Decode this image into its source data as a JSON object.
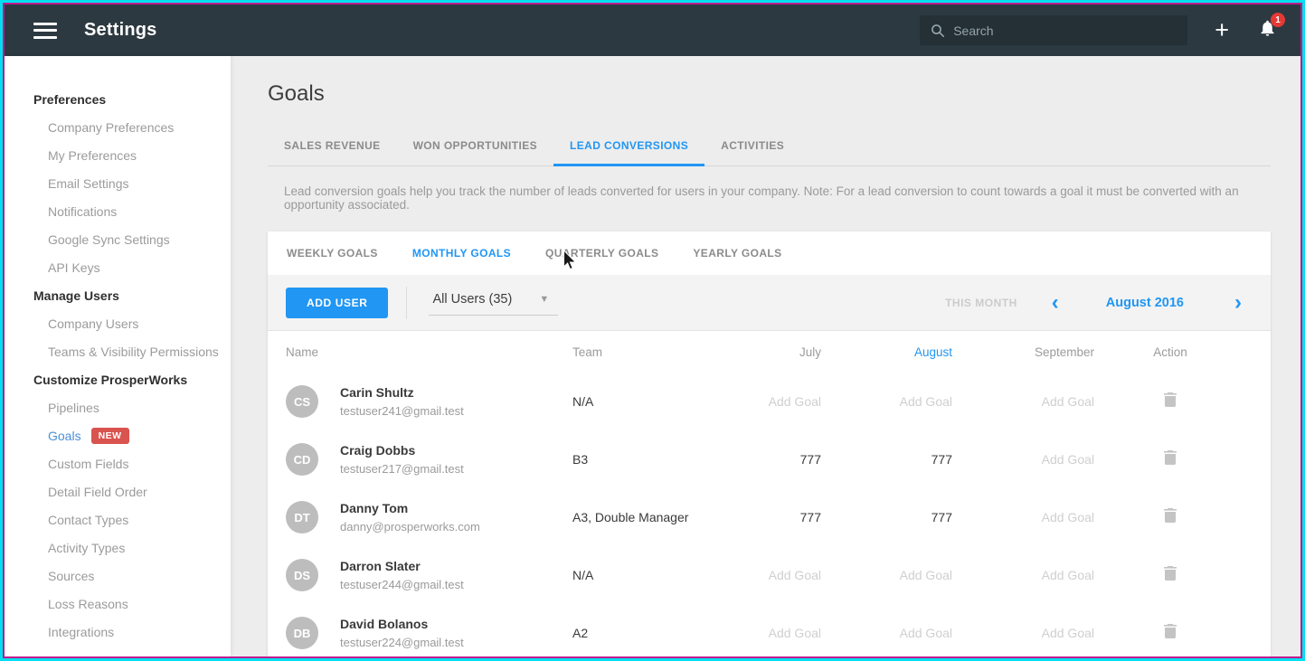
{
  "colors": {
    "accent_blue": "#2196f3",
    "topbar_bg": "#2d3940",
    "new_badge_red": "#d9534f",
    "notification_red": "#e53935",
    "frame_cyan": "#00dff0",
    "frame_magenta": "#bf1b8c"
  },
  "header": {
    "title": "Settings",
    "search_placeholder": "Search",
    "plus_label": "+",
    "notification_count": "1"
  },
  "sidebar": {
    "sections": [
      {
        "title": "Preferences",
        "items": [
          {
            "label": "Company Preferences"
          },
          {
            "label": "My Preferences"
          },
          {
            "label": "Email Settings"
          },
          {
            "label": "Notifications"
          },
          {
            "label": "Google Sync Settings"
          },
          {
            "label": "API Keys"
          }
        ]
      },
      {
        "title": "Manage Users",
        "items": [
          {
            "label": "Company Users"
          },
          {
            "label": "Teams & Visibility Permissions"
          }
        ]
      },
      {
        "title": "Customize ProsperWorks",
        "items": [
          {
            "label": "Pipelines"
          },
          {
            "label": "Goals",
            "badge": "NEW",
            "active": true
          },
          {
            "label": "Custom Fields"
          },
          {
            "label": "Detail Field Order"
          },
          {
            "label": "Contact Types"
          },
          {
            "label": "Activity Types"
          },
          {
            "label": "Sources"
          },
          {
            "label": "Loss Reasons"
          },
          {
            "label": "Integrations"
          }
        ]
      }
    ]
  },
  "main": {
    "title": "Goals",
    "tabs": [
      {
        "label": "SALES REVENUE"
      },
      {
        "label": "WON OPPORTUNITIES"
      },
      {
        "label": "LEAD CONVERSIONS",
        "active": true
      },
      {
        "label": "ACTIVITIES"
      }
    ],
    "description": "Lead conversion goals help you track the number of leads converted for users in your company. Note: For a lead conversion to count towards a goal it must be converted with an opportunity associated.",
    "subtabs": [
      {
        "label": "WEEKLY GOALS"
      },
      {
        "label": "MONTHLY GOALS",
        "active": true
      },
      {
        "label": "QUARTERLY GOALS"
      },
      {
        "label": "YEARLY GOALS"
      }
    ],
    "toolbar": {
      "add_user_label": "ADD USER",
      "filter_value": "All Users (35)",
      "this_month_label": "THIS MONTH",
      "prev_chevron": "‹",
      "period_label": "August 2016",
      "next_chevron": "›"
    },
    "table": {
      "columns": [
        "Name",
        "Team",
        "July",
        "August",
        "September",
        "Action"
      ],
      "active_column": "August",
      "add_goal_placeholder": "Add Goal",
      "rows": [
        {
          "initials": "CS",
          "name": "Carin Shultz",
          "email": "testuser241@gmail.test",
          "team": "N/A",
          "july": "Add Goal",
          "august": "Add Goal",
          "september": "Add Goal"
        },
        {
          "initials": "CD",
          "name": "Craig Dobbs",
          "email": "testuser217@gmail.test",
          "team": "B3",
          "july": "777",
          "august": "777",
          "september": "Add Goal"
        },
        {
          "initials": "DT",
          "name": "Danny Tom",
          "email": "danny@prosperworks.com",
          "team": "A3, Double Manager",
          "july": "777",
          "august": "777",
          "september": "Add Goal"
        },
        {
          "initials": "DS",
          "name": "Darron Slater",
          "email": "testuser244@gmail.test",
          "team": "N/A",
          "july": "Add Goal",
          "august": "Add Goal",
          "september": "Add Goal"
        },
        {
          "initials": "DB",
          "name": "David Bolanos",
          "email": "testuser224@gmail.test",
          "team": "A2",
          "july": "Add Goal",
          "august": "Add Goal",
          "september": "Add Goal"
        }
      ]
    }
  }
}
